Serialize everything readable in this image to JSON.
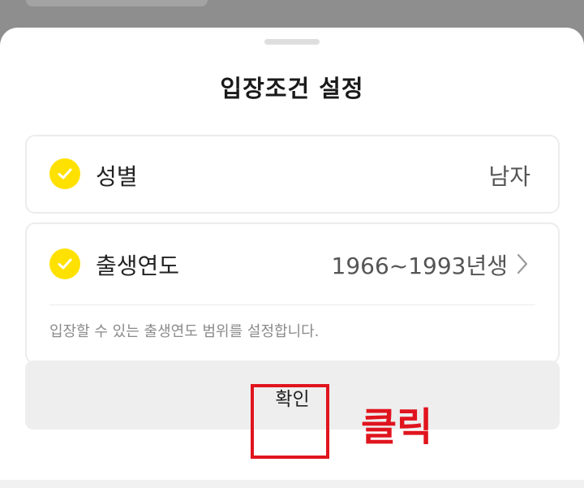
{
  "sheet": {
    "title": "입장조건 설정"
  },
  "conditions": {
    "gender": {
      "label": "성별",
      "value": "남자",
      "checked": true
    },
    "birth_year": {
      "label": "출생연도",
      "value": "1966~1993년생",
      "checked": true,
      "helper": "입장할 수 있는 출생연도 범위를 설정합니다."
    }
  },
  "confirm": {
    "label": "확인"
  },
  "annotation": {
    "text": "클릭",
    "color": "#e0141e"
  },
  "colors": {
    "check_accent": "#ffe100",
    "highlight": "#e0141e"
  },
  "icons": [
    "check-icon",
    "chevron-right-icon"
  ]
}
